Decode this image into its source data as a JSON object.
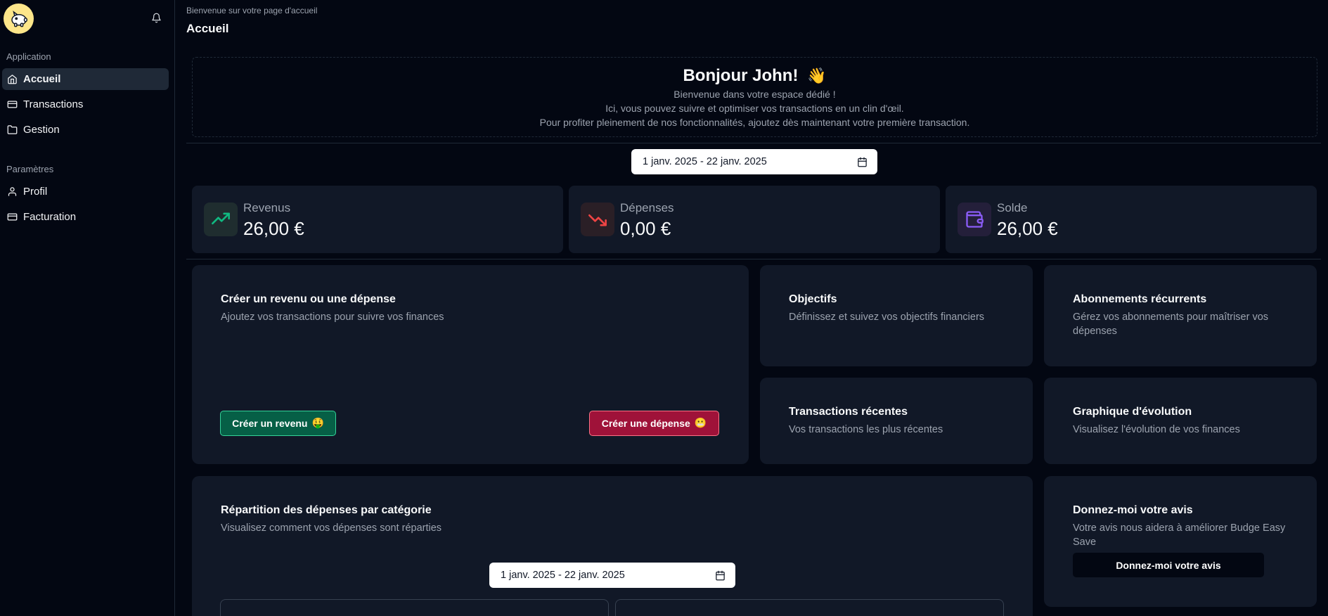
{
  "sidebar": {
    "section_app": "Application",
    "items_app": [
      {
        "label": "Accueil",
        "icon": "home-icon",
        "active": true
      },
      {
        "label": "Transactions",
        "icon": "card-icon"
      },
      {
        "label": "Gestion",
        "icon": "folder-icon"
      }
    ],
    "section_settings": "Paramètres",
    "items_settings": [
      {
        "label": "Profil",
        "icon": "user-icon"
      },
      {
        "label": "Facturation",
        "icon": "card-icon"
      }
    ]
  },
  "header": {
    "breadcrumb": "Bienvenue sur votre page d'accueil",
    "title": "Accueil"
  },
  "welcome": {
    "greeting": "Bonjour John!",
    "wave": "👋",
    "line1": "Bienvenue dans votre espace dédié !",
    "line2": "Ici, vous pouvez suivre et optimiser vos transactions en un clin d'œil.",
    "line3": "Pour profiter pleinement de nos fonctionnalités, ajoutez dès maintenant votre première transaction."
  },
  "date_range": "1 janv. 2025 - 22 janv. 2025",
  "stats": [
    {
      "label": "Revenus",
      "value": "26,00 €",
      "icon": "trending-up-icon",
      "color": "#10b981"
    },
    {
      "label": "Dépenses",
      "value": "0,00 €",
      "icon": "trending-down-icon",
      "color": "#ef4444"
    },
    {
      "label": "Solde",
      "value": "26,00 €",
      "icon": "wallet-icon",
      "color": "#8b5cf6"
    }
  ],
  "create_card": {
    "title": "Créer un revenu ou une dépense",
    "desc": "Ajoutez vos transactions pour suivre vos finances",
    "income_btn": "Créer un revenu",
    "income_emoji": "🤑",
    "expense_btn": "Créer une dépense",
    "expense_emoji": "😬"
  },
  "objectives": {
    "title": "Objectifs",
    "desc": "Définissez et suivez vos objectifs financiers"
  },
  "subscriptions": {
    "title": "Abonnements récurrents",
    "desc": "Gérez vos abonnements pour maîtriser vos dépenses"
  },
  "recent": {
    "title": "Transactions récentes",
    "desc": "Vos transactions les plus récentes"
  },
  "evolution": {
    "title": "Graphique d'évolution",
    "desc": "Visualisez l'évolution de vos finances"
  },
  "breakdown": {
    "title": "Répartition des dépenses par catégorie",
    "desc": "Visualisez comment vos dépenses sont réparties",
    "date_range": "1 janv. 2025 - 22 janv. 2025"
  },
  "feedback": {
    "title": "Donnez-moi votre avis",
    "desc": "Votre avis nous aidera à améliorer Budge Easy Save",
    "button": "Donnez-moi votre avis"
  },
  "colors": {
    "background": "#030712",
    "card": "#111827",
    "border": "#1f2937",
    "muted": "#9ca3af"
  }
}
